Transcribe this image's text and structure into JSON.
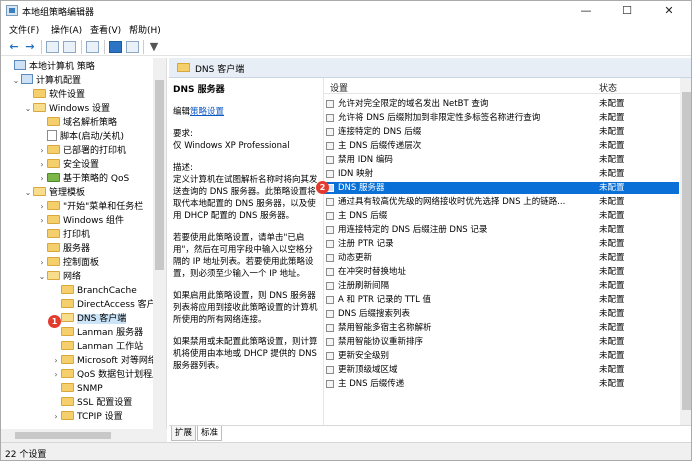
{
  "window": {
    "title": "本地组策略编辑器",
    "controls": {
      "minimize": "—",
      "maximize": "☐",
      "close": "✕"
    }
  },
  "menu": [
    "文件(F)",
    "操作(A)",
    "查看(V)",
    "帮助(H)"
  ],
  "tree": {
    "items": [
      {
        "label": "本地计算机 策略",
        "expander": "",
        "icon": "computer-icon"
      },
      {
        "label": "计算机配置",
        "expander": "⌄",
        "icon": "computer-icon"
      },
      {
        "label": "软件设置",
        "expander": "",
        "icon": "folder-icon"
      },
      {
        "label": "Windows 设置",
        "expander": "⌄",
        "icon": "folder-icon"
      },
      {
        "label": "域名解析策略",
        "expander": "",
        "icon": "folder-icon"
      },
      {
        "label": "脚本(启动/关机)",
        "expander": "",
        "icon": "document-icon"
      },
      {
        "label": "已部署的打印机",
        "expander": "›",
        "icon": "folder-icon"
      },
      {
        "label": "安全设置",
        "expander": "›",
        "icon": "folder-icon"
      },
      {
        "label": "基于策略的 QoS",
        "expander": "›",
        "icon": "chart-icon"
      },
      {
        "label": "管理模板",
        "expander": "⌄",
        "icon": "folder-icon"
      },
      {
        "label": "\"开始\"菜单和任务栏",
        "expander": "›",
        "icon": "folder-icon"
      },
      {
        "label": "Windows 组件",
        "expander": "›",
        "icon": "folder-icon"
      },
      {
        "label": "打印机",
        "expander": "",
        "icon": "folder-icon"
      },
      {
        "label": "服务器",
        "expander": "",
        "icon": "folder-icon"
      },
      {
        "label": "控制面板",
        "expander": "›",
        "icon": "folder-icon"
      },
      {
        "label": "网络",
        "expander": "⌄",
        "icon": "folder-icon"
      },
      {
        "label": "BranchCache",
        "expander": "",
        "icon": "folder-icon"
      },
      {
        "label": "DirectAccess 客户端",
        "expander": "",
        "icon": "folder-icon"
      },
      {
        "label": "DNS 客户端",
        "expander": "",
        "icon": "folder-icon",
        "selected": true
      },
      {
        "label": "Lanman 服务器",
        "expander": "",
        "icon": "folder-icon"
      },
      {
        "label": "Lanman 工作站",
        "expander": "",
        "icon": "folder-icon"
      },
      {
        "label": "Microsoft 对等网络",
        "expander": "›",
        "icon": "folder-icon"
      },
      {
        "label": "QoS 数据包计划程序",
        "expander": "›",
        "icon": "folder-icon"
      },
      {
        "label": "SNMP",
        "expander": "",
        "icon": "folder-icon"
      },
      {
        "label": "SSL 配置设置",
        "expander": "",
        "icon": "folder-icon"
      },
      {
        "label": "TCPIP 设置",
        "expander": "›",
        "icon": "folder-icon"
      }
    ]
  },
  "badges": {
    "tree": "1",
    "list": "2"
  },
  "right": {
    "header": "DNS 客户端",
    "description": {
      "title": "DNS 服务器",
      "edit_prefix": "编辑",
      "edit_link": "策略设置",
      "requirement_label": "要求:",
      "requirement": "仅 Windows XP Professional",
      "desc_label": "描述:",
      "p1": "定义计算机在试图解析名称时将向其发送查询的 DNS 服务器。此策略设置将取代本地配置的 DNS 服务器，以及使用 DHCP 配置的 DNS 服务器。",
      "p2": "若要使用此策略设置，请单击\"已启用\"，然后在可用字段中输入以空格分隔的 IP 地址列表。若要使用此策略设置，则必须至少输入一个 IP 地址。",
      "p3": "如果启用此策略设置，则 DNS 服务器列表将应用到接收此策略设置的计算机所使用的所有网络连接。",
      "p4": "如果禁用或未配置此策略设置，则计算机将使用由本地或 DHCP 提供的 DNS 服务器列表。"
    },
    "columns": {
      "setting": "设置",
      "state": "状态"
    },
    "settings": [
      {
        "name": "允许对完全限定的域名发出 NetBT 查询",
        "state": "未配置"
      },
      {
        "name": "允许将 DNS 后缀附加到非限定性多标签名称进行查询",
        "state": "未配置"
      },
      {
        "name": "连接特定的 DNS 后缀",
        "state": "未配置"
      },
      {
        "name": "主 DNS 后缀传递层次",
        "state": "未配置"
      },
      {
        "name": "禁用 IDN 编码",
        "state": "未配置"
      },
      {
        "name": "IDN 映射",
        "state": "未配置"
      },
      {
        "name": "DNS 服务器",
        "state": "未配置",
        "selected": true
      },
      {
        "name": "通过具有较高优先级的网络接收时优先选择 DNS 上的链路...",
        "state": "未配置"
      },
      {
        "name": "主 DNS 后缀",
        "state": "未配置"
      },
      {
        "name": "用连接特定的 DNS 后缀注册 DNS 记录",
        "state": "未配置"
      },
      {
        "name": "注册 PTR 记录",
        "state": "未配置"
      },
      {
        "name": "动态更新",
        "state": "未配置"
      },
      {
        "name": "在冲突时替换地址",
        "state": "未配置"
      },
      {
        "name": "注册刷新间隔",
        "state": "未配置"
      },
      {
        "name": "A 和 PTR 记录的 TTL 值",
        "state": "未配置"
      },
      {
        "name": "DNS 后缀搜索列表",
        "state": "未配置"
      },
      {
        "name": "禁用智能多宿主名称解析",
        "state": "未配置"
      },
      {
        "name": "禁用智能协议重新排序",
        "state": "未配置"
      },
      {
        "name": "更新安全级别",
        "state": "未配置"
      },
      {
        "name": "更新顶级域区域",
        "state": "未配置"
      },
      {
        "name": "主 DNS 后缀传递",
        "state": "未配置"
      }
    ],
    "tabs": [
      "扩展",
      "标准"
    ]
  },
  "status": "22 个设置",
  "colors": {
    "selection": "#0a6fd6",
    "badge": "#e33b2e",
    "link": "#0b57c5"
  }
}
